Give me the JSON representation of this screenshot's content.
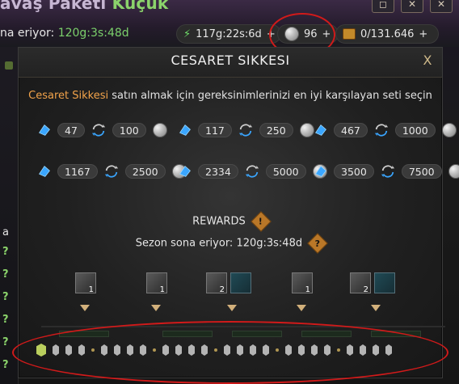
{
  "top": {
    "title_prefix": "avaş Paketi",
    "title_accent": "Küçük",
    "season_prefix": "na eriyor:",
    "season_time": "120g:3s:48d",
    "resources": {
      "energy": "117g:22s:6d",
      "coins": "96",
      "gold": "0/131.646",
      "plus": "+"
    }
  },
  "modal": {
    "title": "CESARET SIKKESI",
    "close": "X",
    "subtitle_prefix": "Cesaret Sikkesi",
    "subtitle_rest": " satın almak için gereksinimlerinizi en iyi karşılayan seti seçin",
    "offers": [
      {
        "give": "47",
        "get": "100"
      },
      {
        "give": "117",
        "get": "250"
      },
      {
        "give": "467",
        "get": "1000"
      },
      {
        "give": "1167",
        "get": "2500"
      },
      {
        "give": "2334",
        "get": "5000"
      },
      {
        "give": "3500",
        "get": "7500"
      }
    ],
    "rewards_title": "REWARDS",
    "rewards_info": "!",
    "season_center": "Sezon sona eriyor: 120g:3s:48d",
    "season_info": "?",
    "reward_badges": [
      "1",
      "1",
      "2",
      "1",
      "2"
    ]
  },
  "side": {
    "letter": "a",
    "questions": [
      "?",
      "?",
      "?",
      "?",
      "?",
      "?"
    ]
  },
  "colors": {
    "accent_orange": "#f2a34a",
    "accent_green": "#7bd06b",
    "annotation_red": "#d11a1a"
  }
}
